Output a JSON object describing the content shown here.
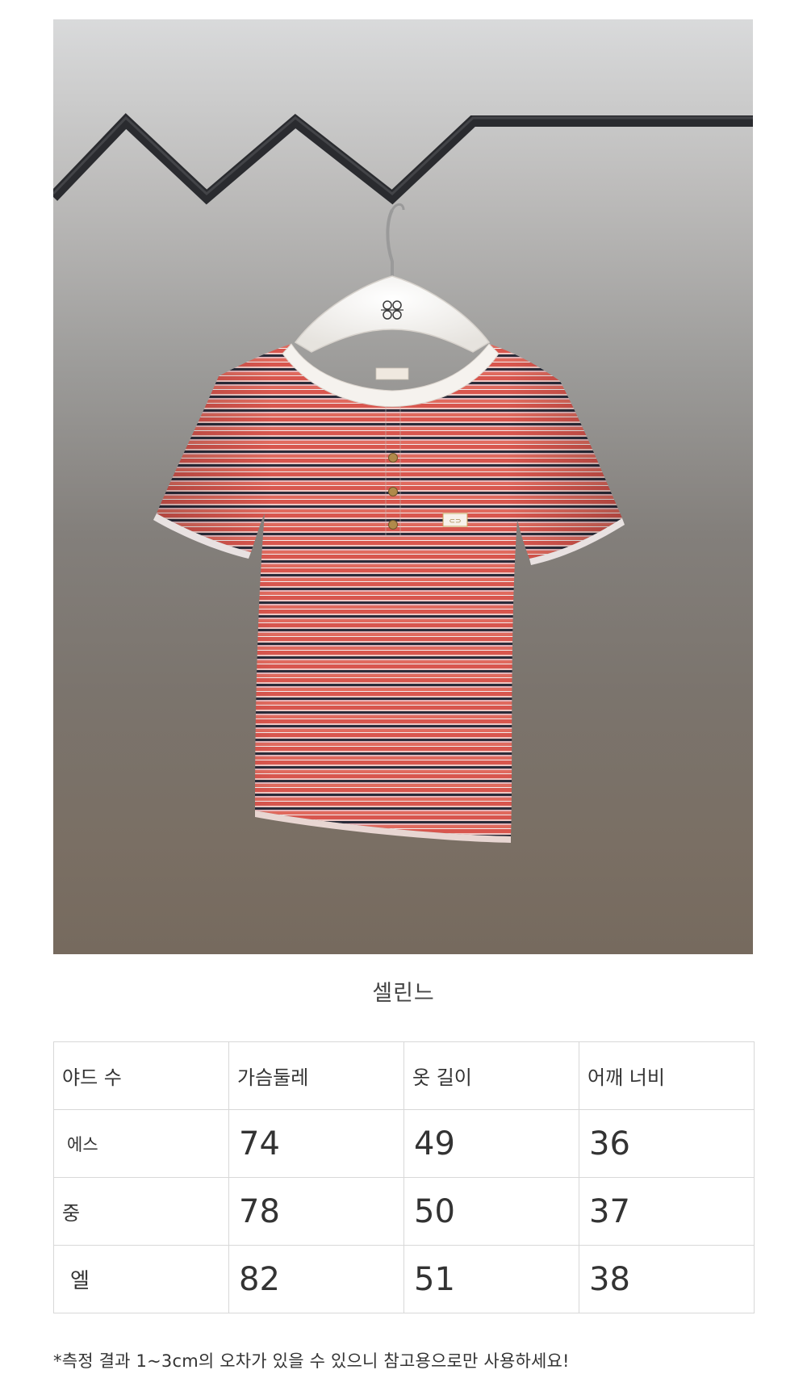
{
  "product": {
    "title": "셀린느",
    "image_alt": "striped short-sleeve henley t-shirt on hanger",
    "hanger_logo_icon": "logo-icon"
  },
  "size_table": {
    "headers": [
      "야드 수",
      "가슴둘레",
      "옷 길이",
      "어깨 너비"
    ],
    "rows": [
      {
        "label": "에스",
        "values": [
          "74",
          "49",
          "36"
        ]
      },
      {
        "label": "중",
        "values": [
          "78",
          "50",
          "37"
        ]
      },
      {
        "label": "엘",
        "values": [
          "82",
          "51",
          "38"
        ]
      }
    ]
  },
  "note": "*측정 결과 1~3cm의 오차가 있을 수 있으니 참고용으로만 사용하세요!",
  "colors": {
    "stripe_red": "#d8564e",
    "stripe_navy": "#2b2c3a",
    "stripe_white": "#f3ecec",
    "collar": "#f5f2ee",
    "rail": "#2a2b2f"
  }
}
